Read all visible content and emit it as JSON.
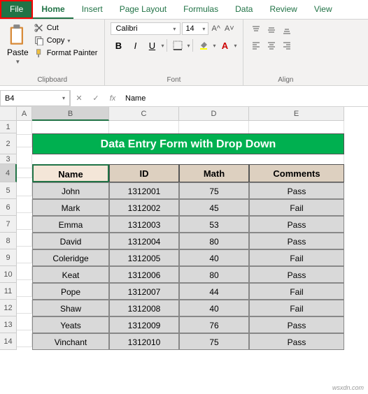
{
  "tabs": {
    "file": "File",
    "home": "Home",
    "insert": "Insert",
    "page_layout": "Page Layout",
    "formulas": "Formulas",
    "data": "Data",
    "review": "Review",
    "view": "View"
  },
  "ribbon": {
    "clipboard": {
      "paste": "Paste",
      "cut": "Cut",
      "copy": "Copy",
      "format_painter": "Format Painter",
      "label": "Clipboard"
    },
    "font": {
      "name": "Calibri",
      "size": "14",
      "label": "Font"
    },
    "alignment": {
      "label": "Alignment"
    }
  },
  "name_box": "B4",
  "formula_value": "Name",
  "columns": [
    "A",
    "B",
    "C",
    "D",
    "E"
  ],
  "title": "Data Entry Form with Drop Down",
  "headers": {
    "name": "Name",
    "id": "ID",
    "math": "Math",
    "comments": "Comments"
  },
  "rows": [
    {
      "n": "5",
      "name": "John",
      "id": "1312001",
      "math": "75",
      "comments": "Pass"
    },
    {
      "n": "6",
      "name": "Mark",
      "id": "1312002",
      "math": "45",
      "comments": "Fail"
    },
    {
      "n": "7",
      "name": "Emma",
      "id": "1312003",
      "math": "53",
      "comments": "Pass"
    },
    {
      "n": "8",
      "name": "David",
      "id": "1312004",
      "math": "80",
      "comments": "Pass"
    },
    {
      "n": "9",
      "name": "Coleridge",
      "id": "1312005",
      "math": "40",
      "comments": "Fail"
    },
    {
      "n": "10",
      "name": "Keat",
      "id": "1312006",
      "math": "80",
      "comments": "Pass"
    },
    {
      "n": "11",
      "name": "Pope",
      "id": "1312007",
      "math": "44",
      "comments": "Fail"
    },
    {
      "n": "12",
      "name": "Shaw",
      "id": "1312008",
      "math": "40",
      "comments": "Fail"
    },
    {
      "n": "13",
      "name": "Yeats",
      "id": "1312009",
      "math": "76",
      "comments": "Pass"
    },
    {
      "n": "14",
      "name": "Vinchant",
      "id": "1312010",
      "math": "75",
      "comments": "Pass"
    }
  ],
  "watermark": "wsxdn.com"
}
